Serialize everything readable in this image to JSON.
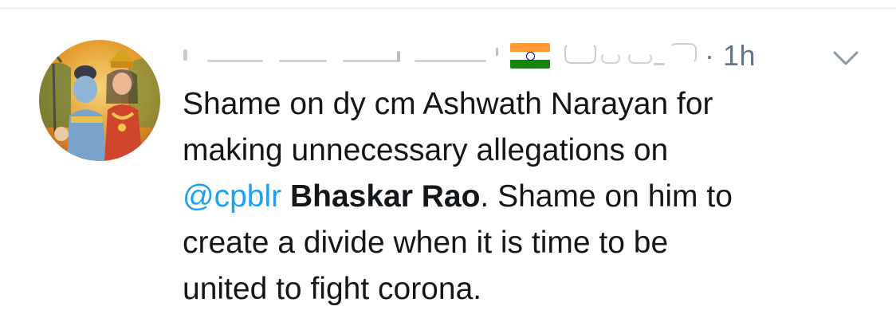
{
  "tweet": {
    "timestamp": "· 1h",
    "flag_icon": "india-flag-icon",
    "menu_icon": "chevron-down-icon",
    "text": {
      "line1": "Shame on dy cm Ashwath Narayan for",
      "line2": "making unnecessary allegations on",
      "mention": "@cpblr",
      "bold": "Bhaskar Rao",
      "after_bold": ". Shame on him to",
      "line4": "create a divide when it is time to be",
      "line5": "united to fight corona."
    }
  },
  "colors": {
    "mention": "#1da1f2",
    "secondary_text": "#657786",
    "primary_text": "#14171a"
  }
}
